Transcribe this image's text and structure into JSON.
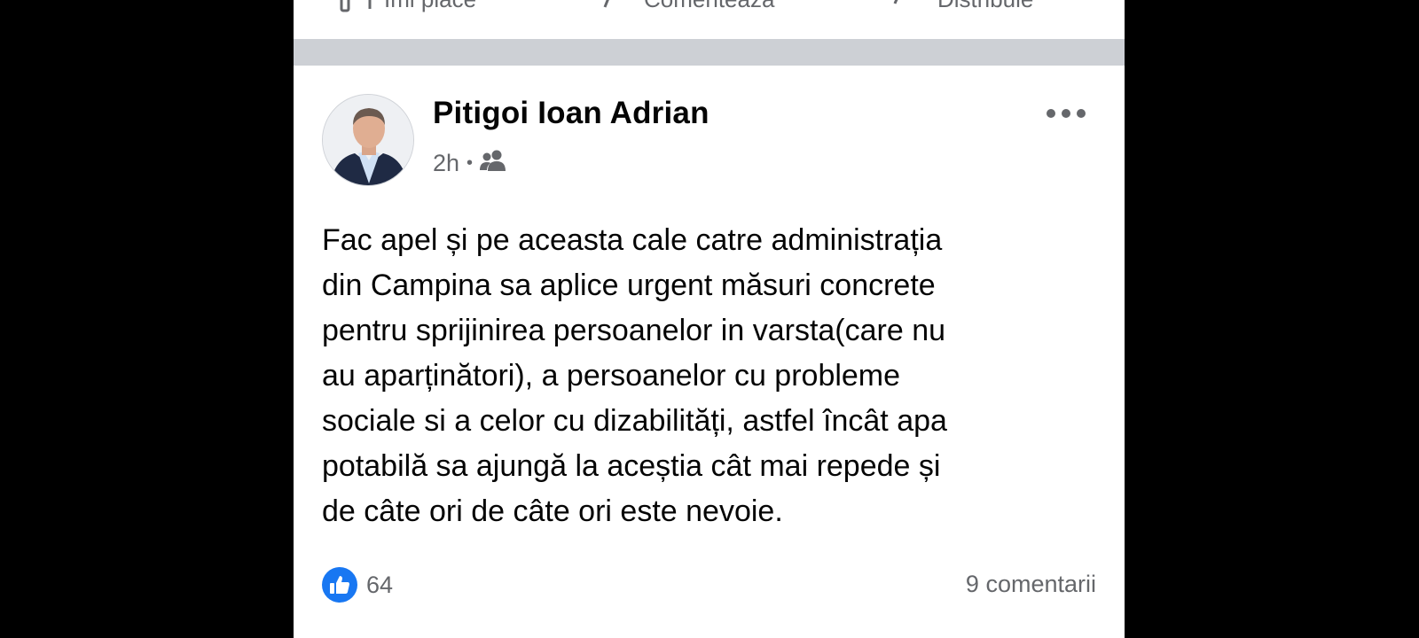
{
  "previous_post_actions": {
    "like_label": "Îmi place",
    "comment_label": "Comentează",
    "share_label": "Distribuie"
  },
  "post": {
    "author": "Pitigoi Ioan Adrian",
    "time": "2h",
    "separator": "•",
    "audience_icon": "friends-icon",
    "text": "Fac apel și pe aceasta cale catre administrația\ndin Campina sa aplice urgent măsuri concrete\npentru sprijinirea persoanelor in varsta(care nu\nau aparținători), a persoanelor cu probleme\nsociale si a celor cu dizabilități, astfel încât apa\npotabilă sa ajungă la aceștia cât mai repede și\nde câte ori de câte ori este nevoie.",
    "reaction_icon": "like-icon",
    "reactions_count": "64",
    "comments_count": "9 comentarii"
  },
  "colors": {
    "page_background": "#000000",
    "card_background": "#ffffff",
    "separator": "#cdd0d5",
    "secondary_text": "#65676b",
    "primary_text": "#050505",
    "like_blue": "#1877f2"
  }
}
